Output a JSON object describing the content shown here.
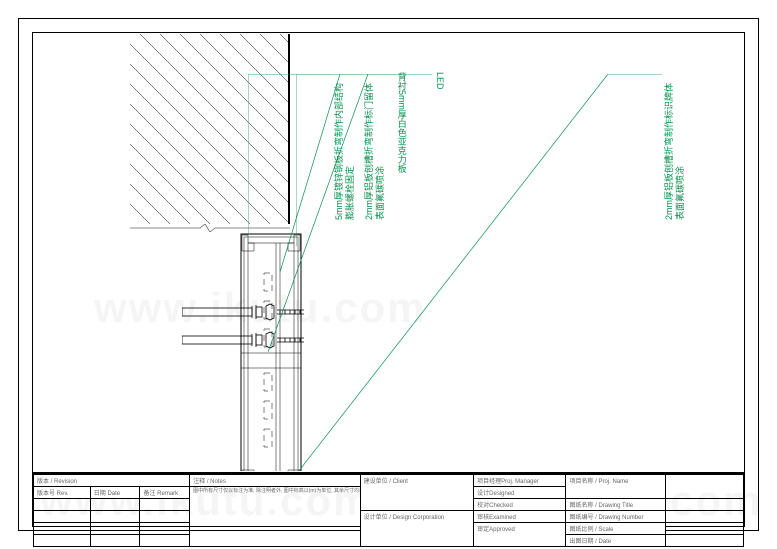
{
  "annotations": {
    "a1": "5mm厚镀锌钢板折弯制作内部结构",
    "a1b": "膨胀螺栓固定",
    "a2": "2mm厚铝板刨槽折弯制作标门留体",
    "a2b": "表面氟碳喷涂",
    "a3": "背衬5mm厚白色亚克力板",
    "a4": "LED",
    "a5": "2mm厚铝板刨槽折弯制作标识牌体",
    "a5b": "表面氟碳喷涂"
  },
  "titleblock": {
    "revision_header": "版本 / Revision",
    "rev_no": "版本号 Rev.",
    "date": "日期 Date",
    "remark": "备注 Remark",
    "notes_header": "注释 / Notes",
    "notes_body": "图中所有尺寸仅以标注为准; 除注明者外, 图中标高以(m)为单位, 其余尺寸均以毫米(mm)为单位; 施工前必须仔细核读所有专业图纸, 防止错误; 施工前必须核对尺寸, 无误模后方可施工; 所有设计变更须征求设计师同意。All dimensions are as shown. All levels are indicated in metre, and the other dimensions are in millimetre unless noted otherwise. All drawings shall be read carefully prior to construction. All dimensions shall be checked prior to construction. Any change to the design shall be agreed in writing by design engineer prior to construction.",
    "client": "建设单位 / Client",
    "design_corp": "设计单位 / Design Corporation",
    "proj_manager": "项目经理Proj. Manager",
    "designed": "设计Designed",
    "checked": "校对Checked",
    "examined": "审核Examined",
    "approved": "审定Approved",
    "proj_name": "项目名称 / Proj. Name",
    "drawing_title": "图纸名称 / Drawing Title",
    "drawing_number": "图纸编号 / Drawing Number",
    "scale": "图纸比例 / Scale",
    "issue_date": "出图日期 / Date"
  },
  "watermark": "www.ikutu.com"
}
